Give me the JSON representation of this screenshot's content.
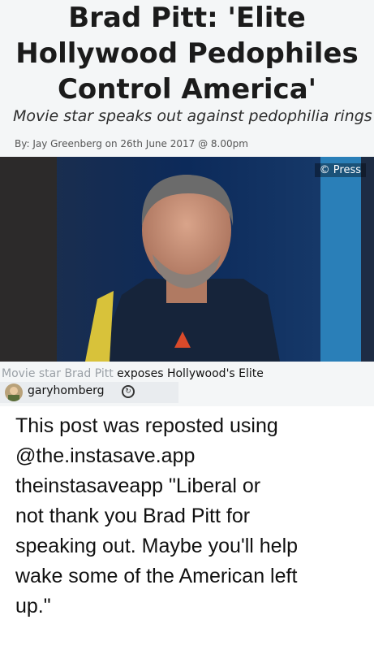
{
  "article": {
    "headline_lines": [
      "Brad Pitt: 'Elite",
      "Hollywood Pedophiles",
      "Control America'"
    ],
    "subtitle": "Movie star speaks out against pedophilia rings",
    "byline": "By: Jay Greenberg on 26th June 2017 @ 8.00pm",
    "photo_credit": "© Press",
    "caption_faded": "Movie star Brad Pitt",
    "caption_rest": " exposes Hollywood's Elite"
  },
  "user": {
    "username": "garyhomberg"
  },
  "post": {
    "lines": [
      "This post was reposted using",
      "@the.instasave.app",
      "theinstasaveapp  \"Liberal or",
      "not thank you Brad Pitt for",
      "speaking out. Maybe you'll help",
      "wake some of the American left",
      "up.\""
    ]
  }
}
